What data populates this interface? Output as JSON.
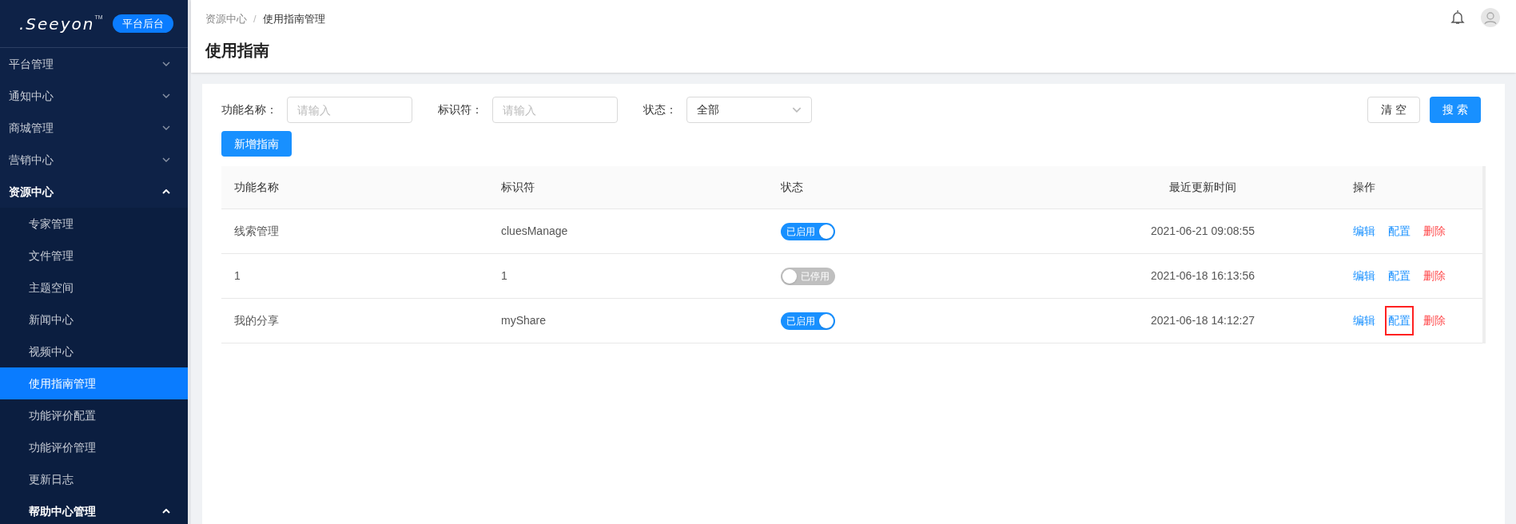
{
  "sidebar": {
    "logo": ".Seeyon",
    "logo_mark": "TM",
    "badge": "平台后台",
    "items": [
      {
        "label": "平台管理",
        "expanded": false
      },
      {
        "label": "通知中心",
        "expanded": false
      },
      {
        "label": "商城管理",
        "expanded": false
      },
      {
        "label": "营销中心",
        "expanded": false
      },
      {
        "label": "资源中心",
        "expanded": true,
        "children": [
          {
            "kind": "item",
            "label": "专家管理",
            "selected": false
          },
          {
            "kind": "item",
            "label": "文件管理",
            "selected": false
          },
          {
            "kind": "item",
            "label": "主题空间",
            "selected": false
          },
          {
            "kind": "item",
            "label": "新闻中心",
            "selected": false
          },
          {
            "kind": "item",
            "label": "视频中心",
            "selected": false
          },
          {
            "kind": "item",
            "label": "使用指南管理",
            "selected": true
          },
          {
            "kind": "item",
            "label": "功能评价配置",
            "selected": false
          },
          {
            "kind": "item",
            "label": "功能评价管理",
            "selected": false
          },
          {
            "kind": "item",
            "label": "更新日志",
            "selected": false
          },
          {
            "kind": "submenu",
            "label": "帮助中心管理",
            "expanded": true
          }
        ]
      }
    ]
  },
  "breadcrumb": {
    "items": [
      "资源中心",
      "使用指南管理"
    ],
    "separator": "/"
  },
  "page_title": "使用指南",
  "filters": [
    {
      "kind": "input",
      "label": "功能名称：",
      "placeholder": "请输入"
    },
    {
      "kind": "input",
      "label": "标识符：",
      "placeholder": "请输入"
    },
    {
      "kind": "select",
      "label": "状态：",
      "value": "全部"
    }
  ],
  "buttons": {
    "clear": "清 空",
    "search": "搜 索",
    "add": "新增指南"
  },
  "table": {
    "columns": [
      "功能名称",
      "标识符",
      "状态",
      "最近更新时间",
      "操作"
    ],
    "rows": [
      {
        "name": "线索管理",
        "id": "cluesManage",
        "enabled": true,
        "status_label": "已启用",
        "updated": "2021-06-21 09:08:55",
        "actions": [
          {
            "kind": "edit",
            "label": "编辑",
            "highlighted": false
          },
          {
            "kind": "config",
            "label": "配置",
            "highlighted": false
          },
          {
            "kind": "delete",
            "label": "删除",
            "highlighted": false
          }
        ]
      },
      {
        "name": "1",
        "id": "1",
        "enabled": false,
        "status_label": "已停用",
        "updated": "2021-06-18 16:13:56",
        "actions": [
          {
            "kind": "edit",
            "label": "编辑",
            "highlighted": false
          },
          {
            "kind": "config",
            "label": "配置",
            "highlighted": false
          },
          {
            "kind": "delete",
            "label": "删除",
            "highlighted": false
          }
        ]
      },
      {
        "name": "我的分享",
        "id": "myShare",
        "enabled": true,
        "status_label": "已启用",
        "updated": "2021-06-18 14:12:27",
        "actions": [
          {
            "kind": "edit",
            "label": "编辑",
            "highlighted": false
          },
          {
            "kind": "config",
            "label": "配置",
            "highlighted": true
          },
          {
            "kind": "delete",
            "label": "删除",
            "highlighted": false
          }
        ]
      }
    ]
  }
}
